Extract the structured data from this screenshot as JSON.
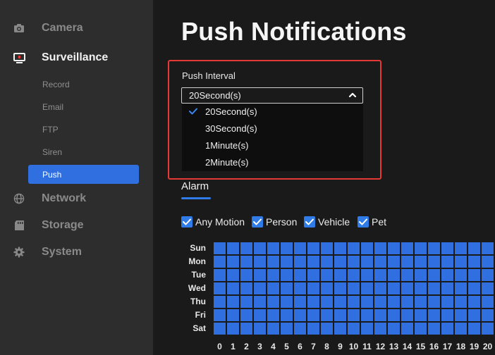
{
  "sidebar": {
    "camera": {
      "label": "Camera",
      "icon": "camera-icon"
    },
    "surveillance": {
      "label": "Surveillance",
      "icon": "monitor-icon"
    },
    "sub_items": [
      {
        "label": "Record"
      },
      {
        "label": "Email"
      },
      {
        "label": "FTP"
      },
      {
        "label": "Siren"
      },
      {
        "label": "Push",
        "active": true
      }
    ],
    "network": {
      "label": "Network",
      "icon": "globe-icon"
    },
    "storage": {
      "label": "Storage",
      "icon": "storage-icon"
    },
    "system": {
      "label": "System",
      "icon": "gear-icon"
    }
  },
  "page": {
    "title": "Push Notifications"
  },
  "push_interval": {
    "label": "Push Interval",
    "selected": "20Second(s)",
    "options": [
      "20Second(s)",
      "30Second(s)",
      "1Minute(s)",
      "2Minute(s)"
    ]
  },
  "alarm": {
    "tab_label": "Alarm",
    "checkboxes": [
      {
        "label": "Any Motion",
        "checked": true
      },
      {
        "label": "Person",
        "checked": true
      },
      {
        "label": "Vehicle",
        "checked": true
      },
      {
        "label": "Pet",
        "checked": true
      }
    ]
  },
  "schedule": {
    "days": [
      "Sun",
      "Mon",
      "Tue",
      "Wed",
      "Thu",
      "Fri",
      "Sat"
    ],
    "hours": [
      "0",
      "1",
      "2",
      "3",
      "4",
      "5",
      "6",
      "7",
      "8",
      "9",
      "10",
      "11",
      "12",
      "13",
      "14",
      "15",
      "16",
      "17",
      "18",
      "19",
      "20"
    ],
    "all_selected": true
  },
  "colors": {
    "accent": "#2f6fe0",
    "highlight_border": "#e53935",
    "sidebar_bg": "#2d2d2d",
    "page_bg": "#1a1a1a"
  }
}
